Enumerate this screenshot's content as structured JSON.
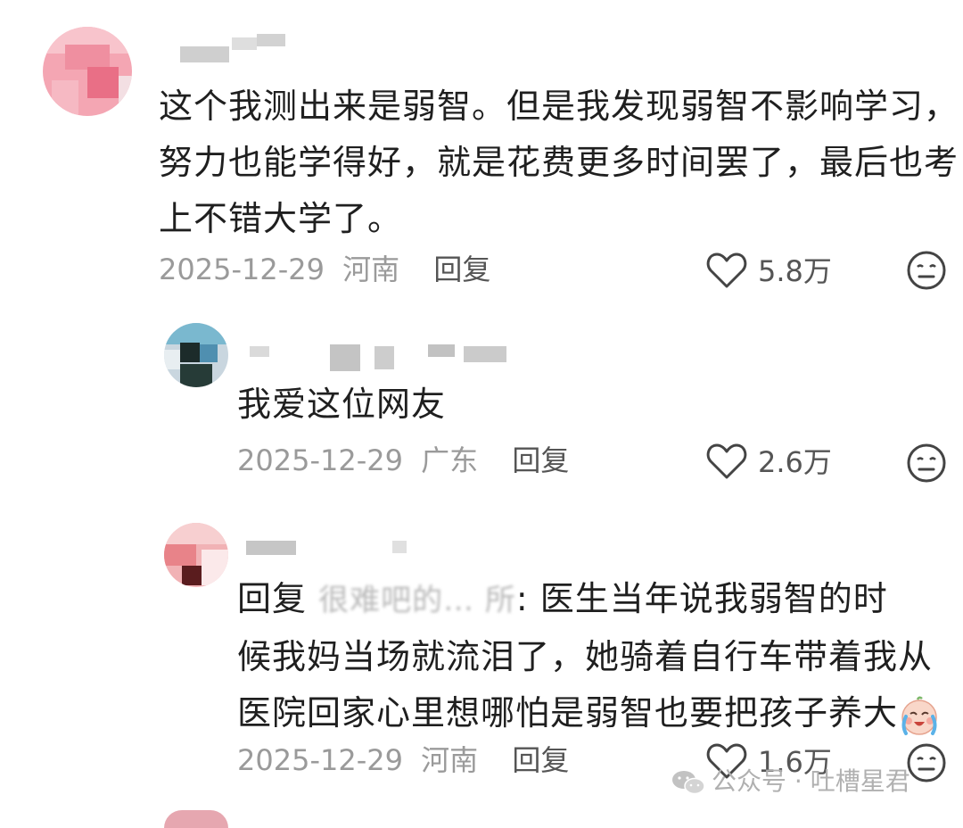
{
  "comments": [
    {
      "text_lines": [
        "这个我测出来是弱智。但是我发现弱智不影响学习，",
        "努力也能学得好，就是花费更多时间罢了，最后也考",
        "上不错大学了。"
      ],
      "date": "2025-12-29",
      "location": "河南",
      "reply_label": "回复",
      "likes": "5.8万"
    },
    {
      "text_lines": [
        "我爱这位网友"
      ],
      "date": "2025-12-29",
      "location": "广东",
      "reply_label": "回复",
      "likes": "2.6万"
    },
    {
      "reply_prefix": "回复",
      "reply_to_blurred": "很难吧的…  所",
      "text_first": ": 医生当年说我弱智的时",
      "text_lines": [
        "候我妈当场就流泪了，她骑着自行车带着我从",
        "医院回家心里想哪怕是弱智也要把孩子养大"
      ],
      "date": "2025-12-29",
      "location": "河南",
      "reply_label": "回复",
      "likes": "1.6万",
      "emoji": "crying-face-emoji"
    }
  ],
  "watermark": {
    "text": "公众号 · 吐槽星君",
    "icon": "wechat-icon"
  },
  "icons": {
    "like": "heart-outline-icon",
    "dislike": "meh-face-icon"
  },
  "colors": {
    "text": "#1f1f1f",
    "meta": "#9a9a9a",
    "watermark": "#b0b0b0"
  }
}
